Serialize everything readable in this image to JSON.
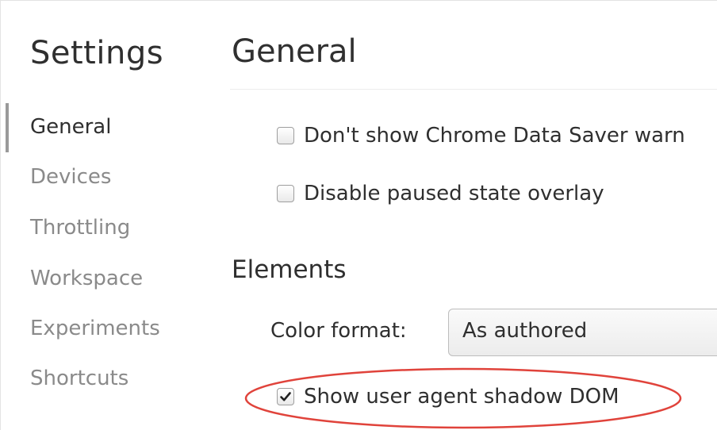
{
  "sidebar": {
    "title": "Settings",
    "items": [
      {
        "label": "General",
        "selected": true
      },
      {
        "label": "Devices",
        "selected": false
      },
      {
        "label": "Throttling",
        "selected": false
      },
      {
        "label": "Workspace",
        "selected": false
      },
      {
        "label": "Experiments",
        "selected": false
      },
      {
        "label": "Shortcuts",
        "selected": false
      }
    ]
  },
  "main": {
    "title": "General",
    "general_options": [
      {
        "label": "Don't show Chrome Data Saver warn",
        "checked": false
      },
      {
        "label": "Disable paused state overlay",
        "checked": false
      }
    ],
    "elements_section": {
      "title": "Elements",
      "color_format_label": "Color format:",
      "color_format_value": "As authored",
      "shadow_dom_option": {
        "label": "Show user agent shadow DOM",
        "checked": true
      }
    }
  },
  "annotation": {
    "highlight_color": "#e0433b"
  },
  "colors": {
    "text_primary": "#2f2f2f",
    "text_secondary": "#8a8a8a",
    "selected_indicator": "#9a9a9a"
  }
}
